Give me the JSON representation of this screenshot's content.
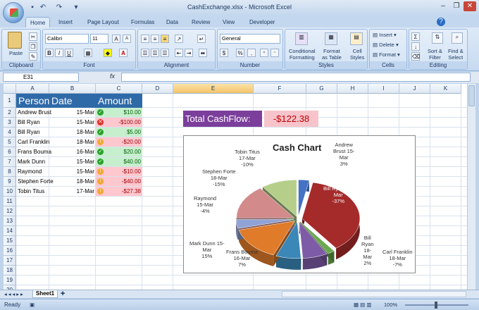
{
  "window": {
    "title": "CashExchange.xlsx - Microsoft Excel",
    "controls": [
      "–",
      "❐",
      "✕"
    ]
  },
  "tabs": [
    "Home",
    "Insert",
    "Page Layout",
    "Formulas",
    "Data",
    "Review",
    "View",
    "Developer"
  ],
  "ribbon": {
    "clipboard": {
      "label": "Clipboard",
      "paste": "Paste"
    },
    "font": {
      "label": "Font",
      "name": "Calibri",
      "size": "11"
    },
    "alignment": {
      "label": "Alignment"
    },
    "number": {
      "label": "Number",
      "format": "General",
      "currency": "$",
      "percent": "%",
      "comma": ","
    },
    "styles": {
      "label": "Styles",
      "conditional": [
        "Conditional",
        "Formatting"
      ],
      "format_table": [
        "Format",
        "as Table"
      ],
      "cell_styles": [
        "Cell",
        "Styles"
      ]
    },
    "cells": {
      "label": "Cells",
      "insert": "Insert",
      "delete": "Delete",
      "format": "Format"
    },
    "editing": {
      "label": "Editing",
      "sort": [
        "Sort &",
        "Filter"
      ],
      "find": [
        "Find &",
        "Select"
      ]
    }
  },
  "formula_bar": {
    "name_box": "E31",
    "fx": "fx",
    "formula": ""
  },
  "columns": [
    "A",
    "B",
    "C",
    "D",
    "E",
    "F",
    "G",
    "H",
    "I",
    "J",
    "K"
  ],
  "rows": [
    "1",
    "2",
    "3",
    "4",
    "5",
    "6",
    "7",
    "8",
    "9",
    "10",
    "11",
    "12",
    "13",
    "14",
    "15",
    "16",
    "17",
    "18",
    "19",
    "20"
  ],
  "table": {
    "headers": [
      "Person",
      "Date",
      "Amount"
    ],
    "rows": [
      {
        "person": "Andrew Brust",
        "date": "15-Mar",
        "amount": "$10.00",
        "status": "ok"
      },
      {
        "person": "Bill Ryan",
        "date": "15-Mar",
        "amount": "-$100.00",
        "status": "bad"
      },
      {
        "person": "Bill Ryan",
        "date": "18-Mar",
        "amount": "$5.00",
        "status": "ok"
      },
      {
        "person": "Carl Franklin",
        "date": "18-Mar",
        "amount": "-$20.00",
        "status": "warn"
      },
      {
        "person": "Frans Bouma",
        "date": "16-Mar",
        "amount": "$20.00",
        "status": "ok"
      },
      {
        "person": "Mark Dunn",
        "date": "15-Mar",
        "amount": "$40.00",
        "status": "ok"
      },
      {
        "person": "Raymond",
        "date": "15-Mar",
        "amount": "-$10.00",
        "status": "warn"
      },
      {
        "person": "Stephen Forte",
        "date": "18-Mar",
        "amount": "-$40.00",
        "status": "warn"
      },
      {
        "person": "Tobin Titus",
        "date": "17-Mar",
        "amount": "-$27.38",
        "status": "warn"
      }
    ]
  },
  "total": {
    "label": "Total CashFlow:",
    "value": "-$122.38"
  },
  "chart_data": {
    "type": "pie",
    "title": "Cash Chart",
    "slices": [
      {
        "label": [
          "Andrew",
          "Brust 15-",
          "Mar",
          "3%"
        ],
        "value": 3,
        "color": "#4472c4"
      },
      {
        "label": [
          "Bill Ryan 15-",
          "Mar",
          "-37%"
        ],
        "value": 37,
        "color": "#a52a2a"
      },
      {
        "label": [
          "Bill",
          "Ryan",
          "18-",
          "Mar",
          "2%"
        ],
        "value": 2,
        "color": "#6aa84f"
      },
      {
        "label": [
          "Carl Franklin",
          "18-Mar",
          "-7%"
        ],
        "value": 7,
        "color": "#7d5ba6"
      },
      {
        "label": [
          "Frans Bouma",
          "16-Mar",
          "7%"
        ],
        "value": 7,
        "color": "#3a87b8"
      },
      {
        "label": [
          "Mark Dunn 15-",
          "Mar",
          "15%"
        ],
        "value": 15,
        "color": "#e07b2a"
      },
      {
        "label": [
          "Raymond",
          "15-Mar",
          "-4%"
        ],
        "value": 4,
        "color": "#8fa3d6"
      },
      {
        "label": [
          "Stephen Forte",
          "18-Mar",
          "-15%"
        ],
        "value": 15,
        "color": "#d28a8a"
      },
      {
        "label": [
          "Tobin Titus",
          "17-Mar",
          "-10%"
        ],
        "value": 10,
        "color": "#b5cf8a"
      }
    ]
  },
  "sheets": [
    "Sheet1"
  ],
  "status": {
    "ready": "Ready",
    "zoom": "100%"
  }
}
